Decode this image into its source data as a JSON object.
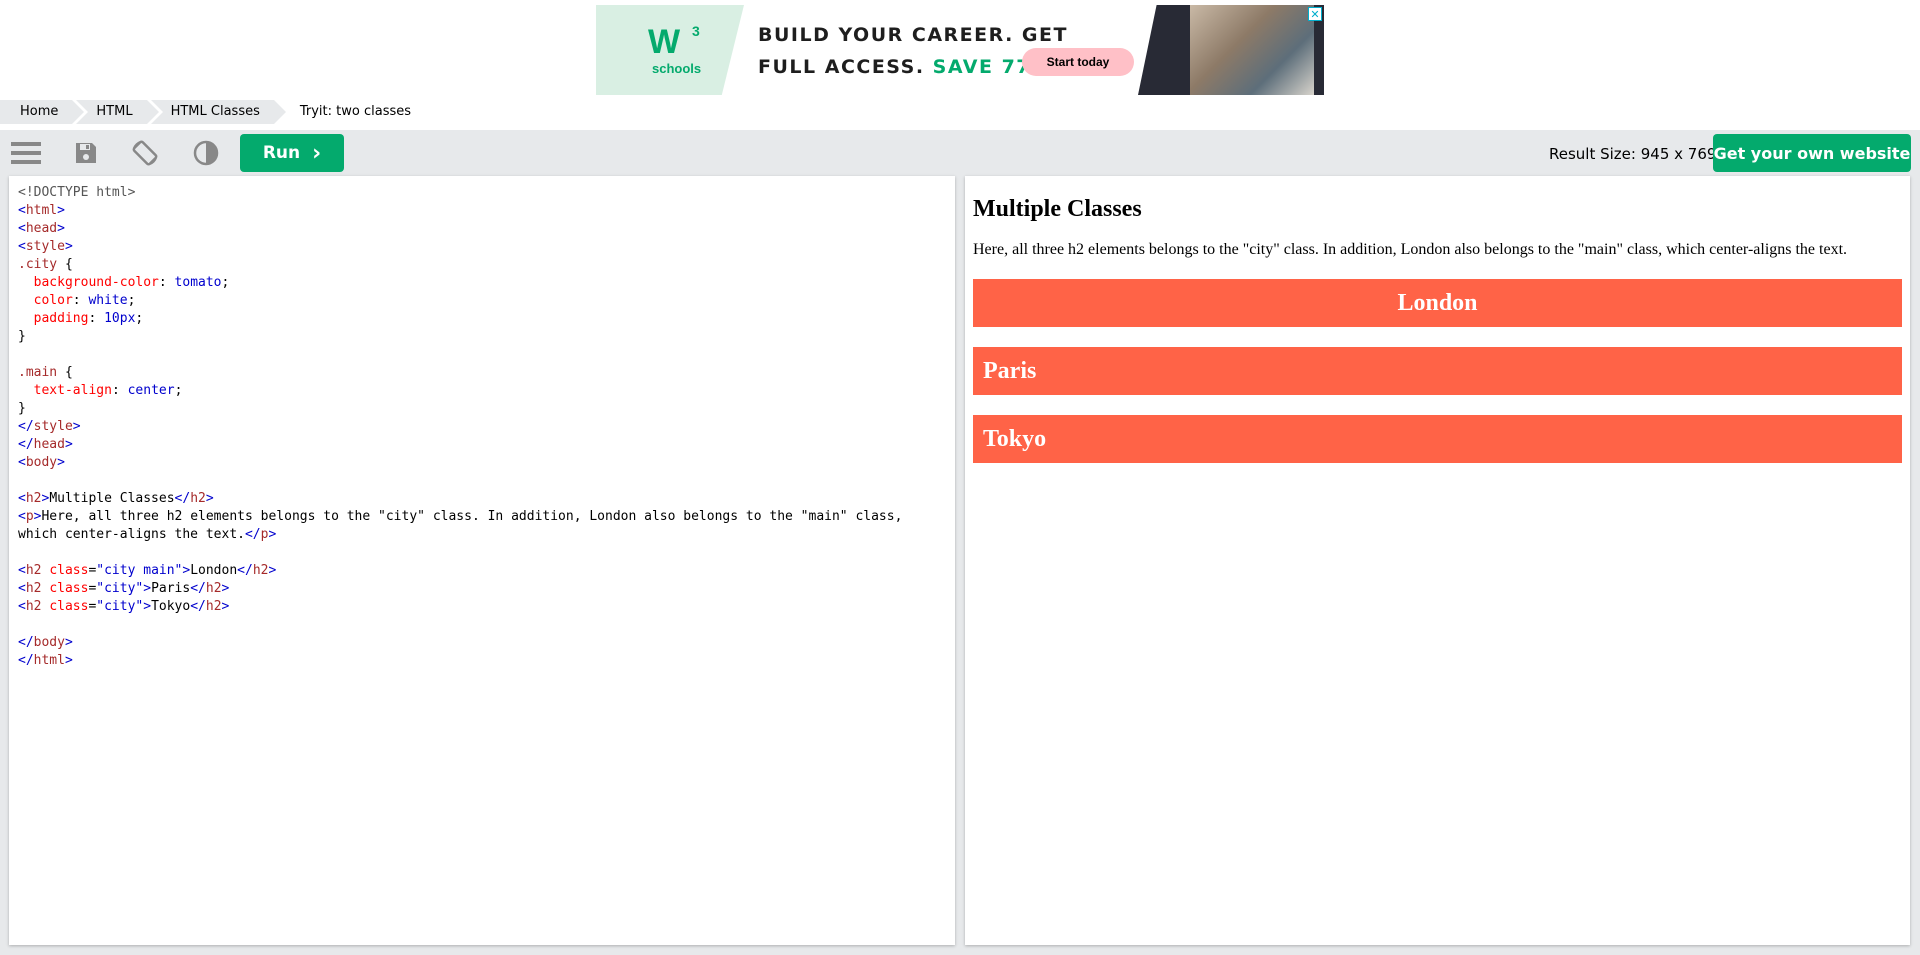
{
  "ad": {
    "logo_main": "W",
    "logo_sup": "3",
    "logo_sub": "schools",
    "headline_line1": "BUILD YOUR CAREER. GET",
    "headline_line2": "FULL ACCESS.",
    "headline_save": "SAVE 770$",
    "cta": "Start today",
    "close": "✕"
  },
  "breadcrumb": [
    "Home",
    "HTML",
    "HTML Classes",
    "Tryit: two classes"
  ],
  "toolbar": {
    "run_label": "Run",
    "run_chevron": "›",
    "result_size": "Result Size: 945 x 769",
    "own_site": "Get your own website"
  },
  "editor": {
    "lines": [
      "<!DOCTYPE html>",
      "<html>",
      "<head>",
      "<style>",
      ".city {",
      "  background-color: tomato;",
      "  color: white;",
      "  padding: 10px;",
      "}",
      "",
      ".main {",
      "  text-align: center;",
      "}",
      "</style>",
      "</head>",
      "<body>",
      "",
      "<h2>Multiple Classes</h2>",
      "<p>Here, all three h2 elements belongs to the \"city\" class. In addition, London also belongs to the \"main\" class,",
      "which center-aligns the text.</p>",
      "",
      "<h2 class=\"city main\">London</h2>",
      "<h2 class=\"city\">Paris</h2>",
      "<h2 class=\"city\">Tokyo</h2>",
      "",
      "</body>",
      "</html>"
    ]
  },
  "result": {
    "title": "Multiple Classes",
    "paragraph": "Here, all three h2 elements belongs to the \"city\" class. In addition, London also belongs to the \"main\" class, which center-aligns the text.",
    "cities": [
      "London",
      "Paris",
      "Tokyo"
    ]
  },
  "colors": {
    "accent": "#04aa6d",
    "city_bg": "#ff6347",
    "toolbar_bg": "#e7e9eb"
  }
}
